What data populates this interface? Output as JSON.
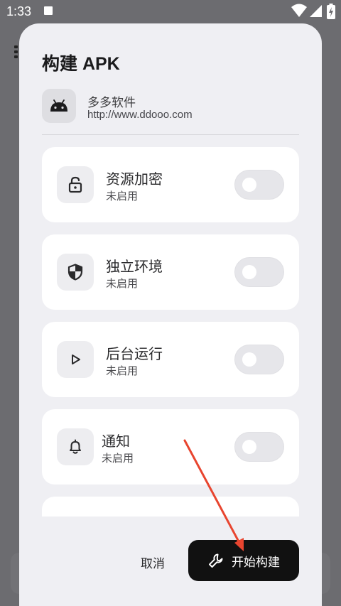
{
  "status_bar": {
    "time": "1:33"
  },
  "dialog": {
    "title": "构建 APK",
    "app": {
      "name": "多多软件",
      "url": "http://www.ddooo.com"
    },
    "options": [
      {
        "title": "资源加密",
        "status": "未启用",
        "icon": "lock-icon",
        "enabled": false
      },
      {
        "title": "独立环境",
        "status": "未启用",
        "icon": "shield-icon",
        "enabled": false
      },
      {
        "title": "后台运行",
        "status": "未启用",
        "icon": "play-icon",
        "enabled": false
      },
      {
        "title": "通知",
        "status": "未启用",
        "icon": "bell-icon",
        "enabled": false
      }
    ],
    "buttons": {
      "cancel": "取消",
      "build": "开始构建"
    }
  },
  "colors": {
    "scrim": "#6c6c70",
    "dialog_bg": "#efeff3",
    "card_bg": "#ffffff",
    "primary_button": "#111111",
    "annotation_arrow": "#e8452f"
  }
}
